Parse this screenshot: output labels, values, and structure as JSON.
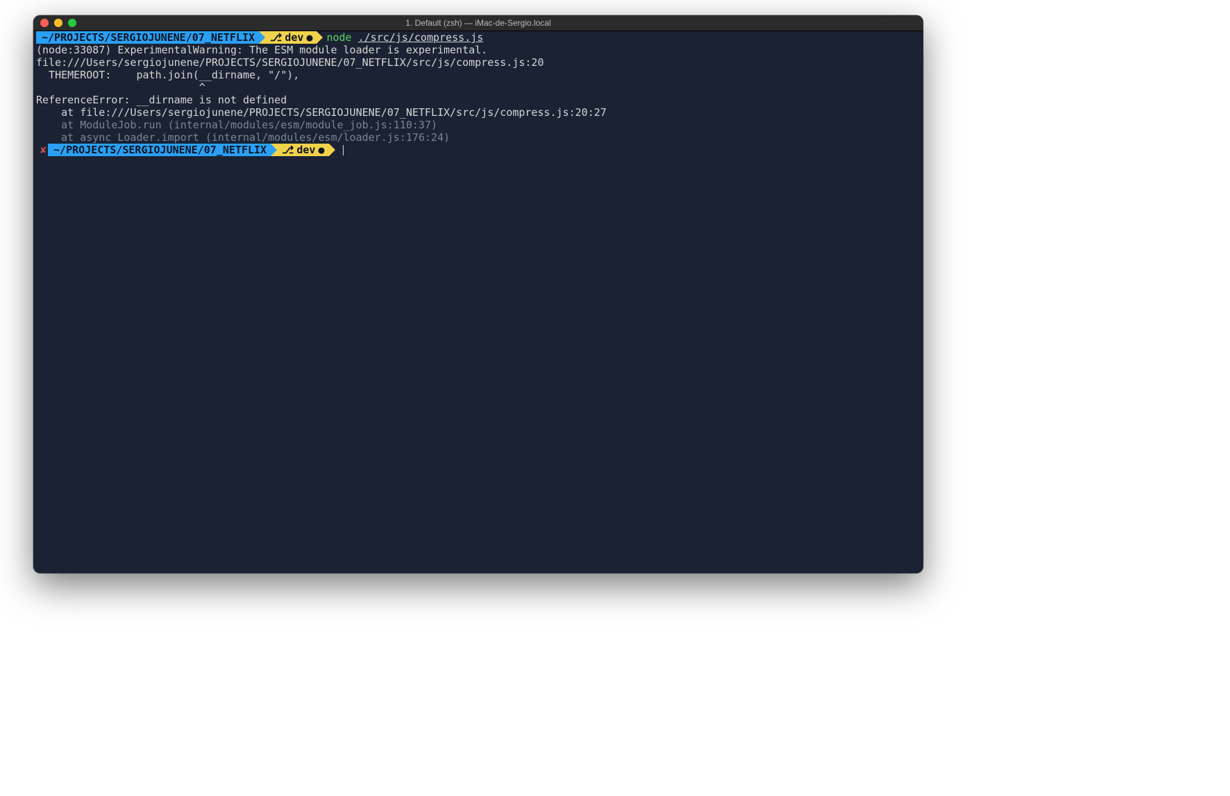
{
  "window": {
    "title": "1. Default (zsh) — iMac-de-Sergio.local"
  },
  "prompt1": {
    "status": "",
    "path": "~/PROJECTS/SERGIOJUNENE/07_NETFLIX",
    "branch_icon": "⎇",
    "branch": "dev",
    "dirty": "●",
    "cmd_node": "node",
    "cmd_arg": "./src/js/compress.js"
  },
  "output": {
    "l1": "(node:33087) ExperimentalWarning: The ESM module loader is experimental.",
    "l2": "file:///Users/sergiojunene/PROJECTS/SERGIOJUNENE/07_NETFLIX/src/js/compress.js:20",
    "l3": "  THEMEROOT:    path.join(__dirname, \"/\"),",
    "l4": "                          ^",
    "l5": "",
    "l6": "ReferenceError: __dirname is not defined",
    "l7": "    at file:///Users/sergiojunene/PROJECTS/SERGIOJUNENE/07_NETFLIX/src/js/compress.js:20:27",
    "l8": "    at ModuleJob.run (internal/modules/esm/module_job.js:110:37)",
    "l9": "    at async Loader.import (internal/modules/esm/loader.js:176:24)"
  },
  "prompt2": {
    "status": "✘",
    "path": "~/PROJECTS/SERGIOJUNENE/07_NETFLIX",
    "branch_icon": "⎇",
    "branch": "dev",
    "dirty": "●"
  }
}
